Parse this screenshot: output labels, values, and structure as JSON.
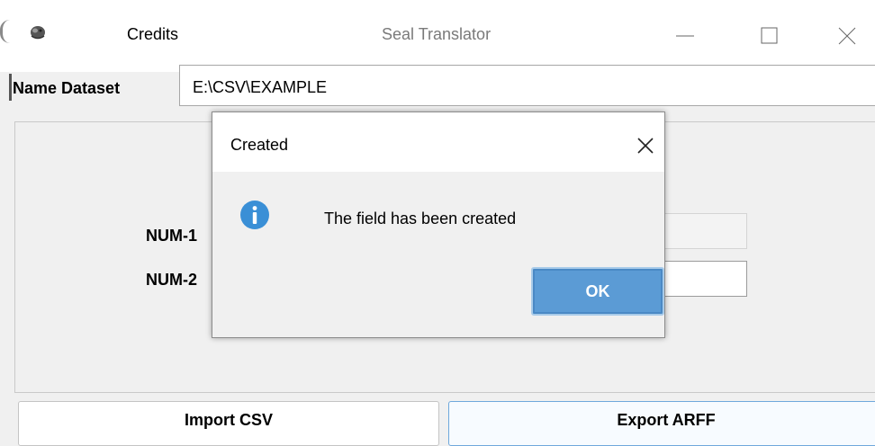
{
  "window": {
    "title": "Seal Translator",
    "menu_credits": "Credits"
  },
  "dataset": {
    "label": "Name Dataset",
    "value": "E:\\CSV\\EXAMPLE"
  },
  "fields": {
    "num1_label": "NUM-1",
    "num2_label": "NUM-2"
  },
  "buttons": {
    "import_label": "Import CSV",
    "export_label": "Export ARFF"
  },
  "dialog": {
    "title": "Created",
    "message": "The field has been created",
    "ok_label": "OK"
  },
  "icons": {
    "app": "seal-icon",
    "minimize": "minimize-icon",
    "maximize": "maximize-icon",
    "close": "close-icon",
    "info": "info-icon"
  },
  "colors": {
    "accent": "#5b9bd5",
    "info_icon": "#3a8fd6"
  }
}
